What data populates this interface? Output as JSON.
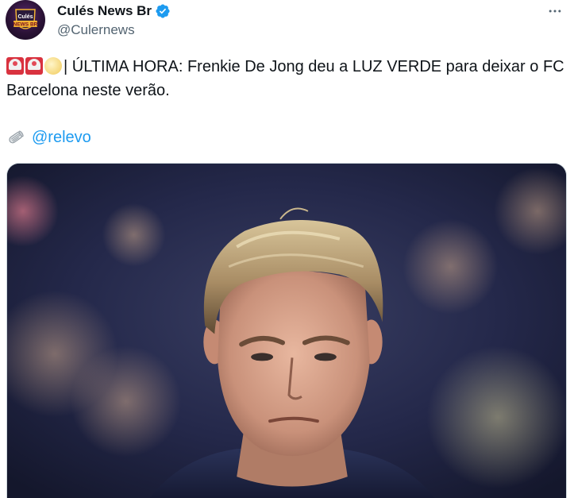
{
  "author": {
    "display_name": "Culés News Br",
    "handle": "@Culernews",
    "avatar_text_top": "Culés",
    "avatar_text_bottom": "NEWS BR"
  },
  "tweet": {
    "text_line": "| ÚLTIMA HORA: Frenkie De Jong deu a LUZ VERDE para deixar o FC Barcelona neste verão.",
    "emojis": [
      "rotating-light-icon",
      "rotating-light-icon",
      "full-moon-icon"
    ],
    "source_icon": "newspaper-icon",
    "source_mention": "@relevo"
  },
  "icons": {
    "verified": "verified-badge-icon",
    "more": "more-options-icon"
  },
  "colors": {
    "link": "#1d9bf0",
    "verified": "#1d9bf0",
    "secondary_text": "#536471"
  }
}
